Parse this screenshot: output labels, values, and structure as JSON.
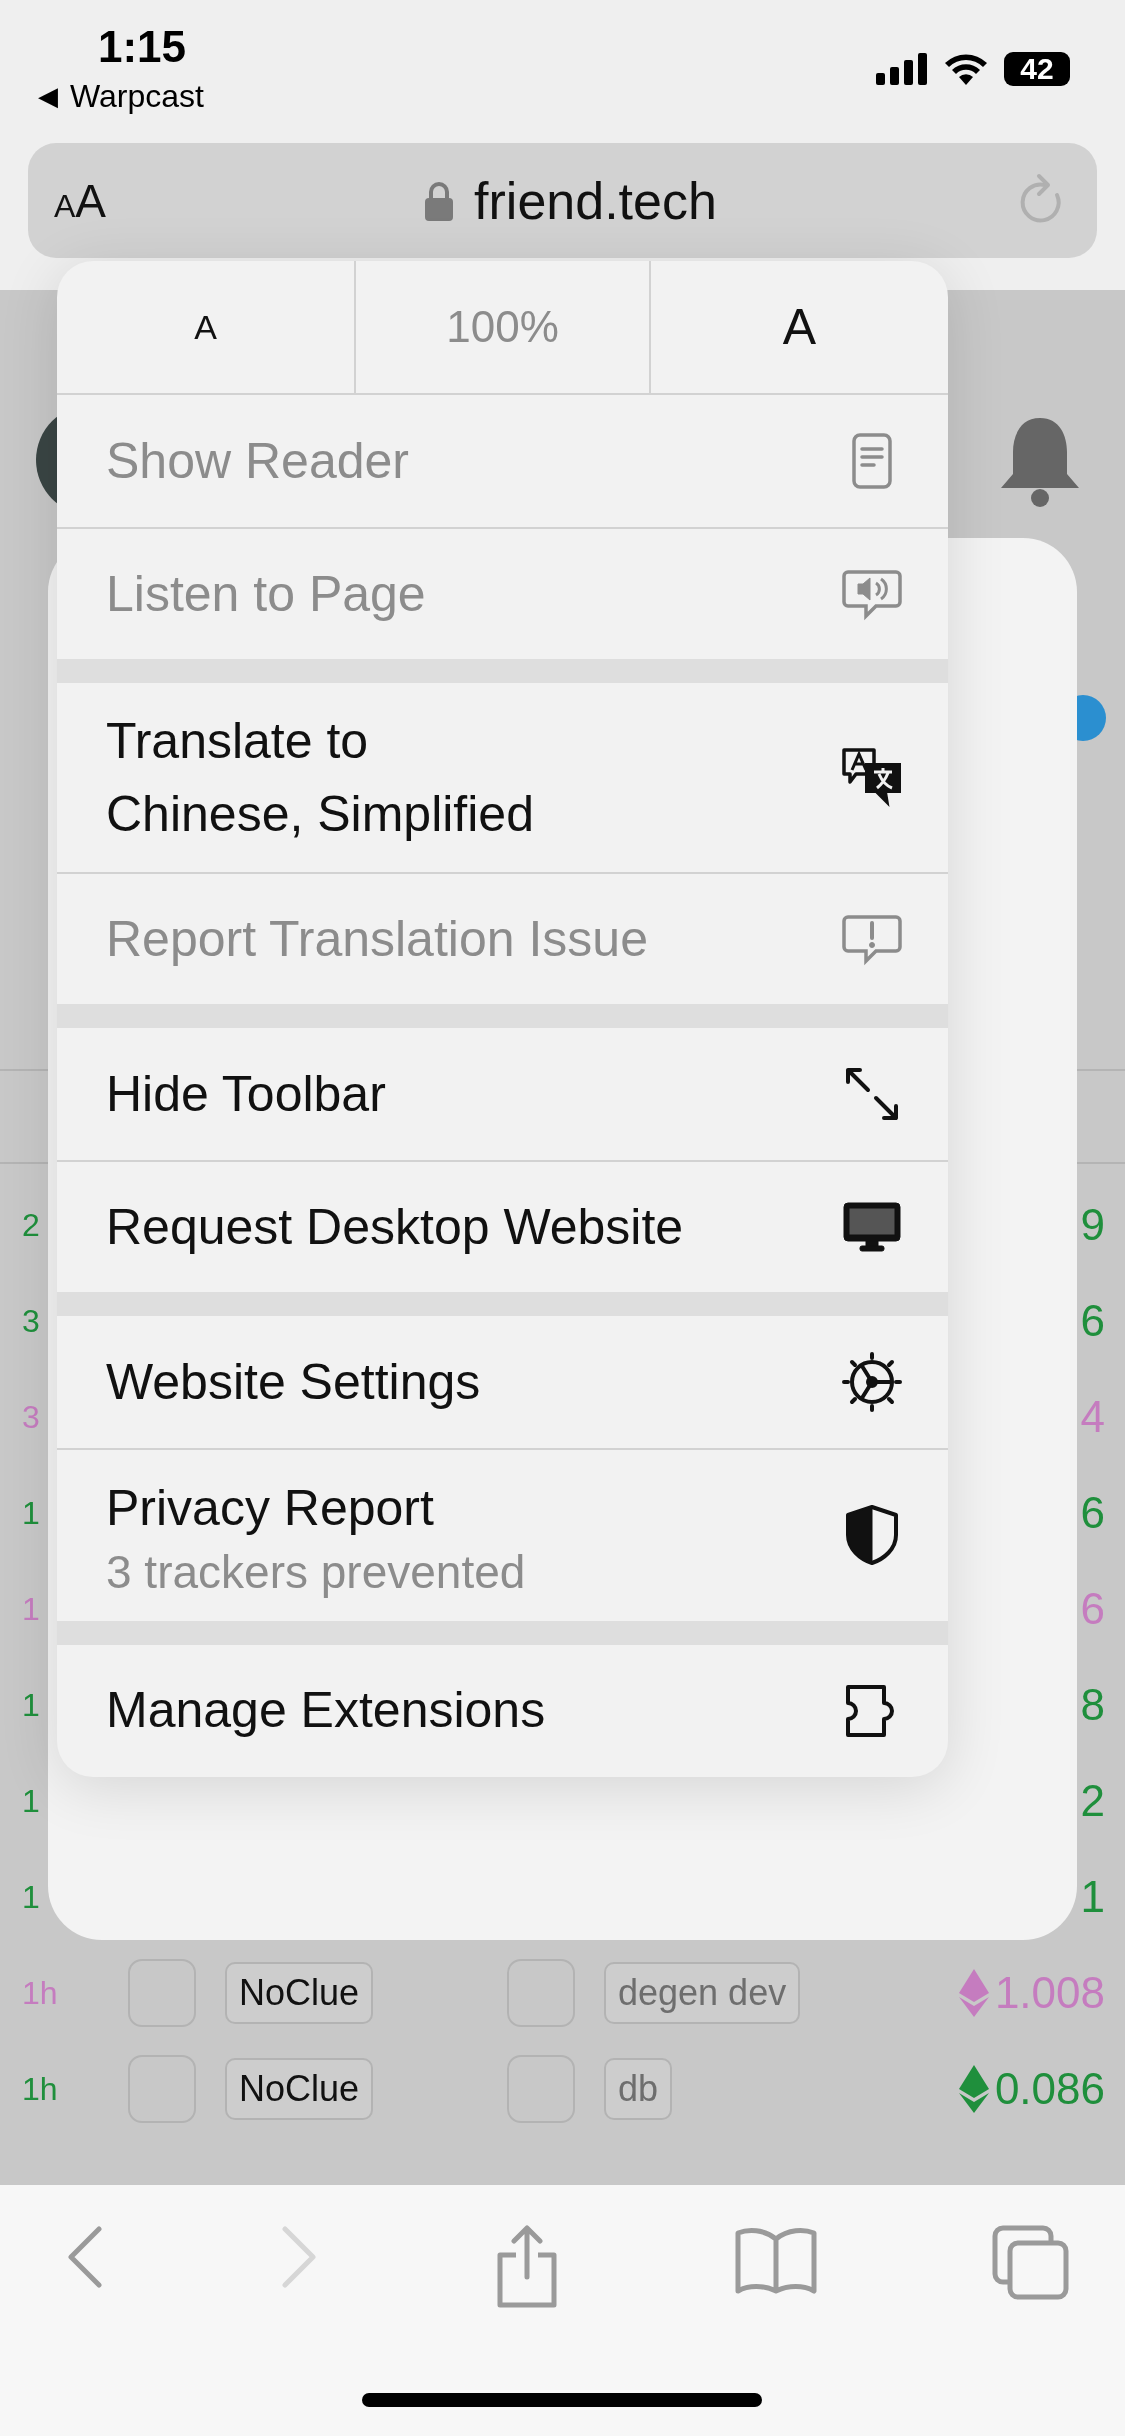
{
  "status_bar": {
    "time": "1:15",
    "back_arrow": "◀",
    "back_app": "Warpcast",
    "battery": "42"
  },
  "address_bar": {
    "format_small": "A",
    "format_large": "A",
    "url": "friend.tech"
  },
  "page": {
    "rows": [
      {
        "time": "2",
        "value": "9",
        "color": "#1f8f3c"
      },
      {
        "time": "3",
        "value": "6",
        "color": "#1f8f3c"
      },
      {
        "time": "3",
        "value": "4",
        "color": "#c57cbf"
      },
      {
        "time": "1",
        "value": "6",
        "color": "#1f8f3c"
      },
      {
        "time": "1",
        "value": "6",
        "color": "#c57cbf"
      },
      {
        "time": "1",
        "value": "8",
        "color": "#1f8f3c"
      },
      {
        "time": "1",
        "value": "2",
        "color": "#1f8f3c"
      },
      {
        "time": "1",
        "value": "1",
        "color": "#1f8f3c"
      }
    ],
    "trades": [
      {
        "time": "1h",
        "trader": "NoClue",
        "subject": "degen dev",
        "price": "1.008",
        "color": "#c57cbf"
      },
      {
        "time": "1h",
        "trader": "NoClue",
        "subject": "db",
        "price": "0.086",
        "color": "#1f8f3c"
      }
    ]
  },
  "menu": {
    "zoom": {
      "smaller": "A",
      "level": "100%",
      "larger": "A"
    },
    "groups": [
      [
        {
          "label": "Show Reader",
          "disabled": true
        },
        {
          "label": "Listen to Page",
          "disabled": true
        }
      ],
      [
        {
          "label": "Translate to\nChinese, Simplified",
          "disabled": false
        },
        {
          "label": "Report Translation Issue",
          "disabled": true
        }
      ],
      [
        {
          "label": "Hide Toolbar",
          "disabled": false
        },
        {
          "label": "Request Desktop Website",
          "disabled": false
        }
      ],
      [
        {
          "label": "Website Settings",
          "disabled": false
        },
        {
          "label": "Privacy Report",
          "sublabel": "3 trackers prevented",
          "disabled": false
        }
      ],
      [
        {
          "label": "Manage Extensions",
          "disabled": false
        }
      ]
    ]
  },
  "toolbar": {
    "back": {
      "disabled": false
    },
    "forward": {
      "disabled": true
    }
  }
}
